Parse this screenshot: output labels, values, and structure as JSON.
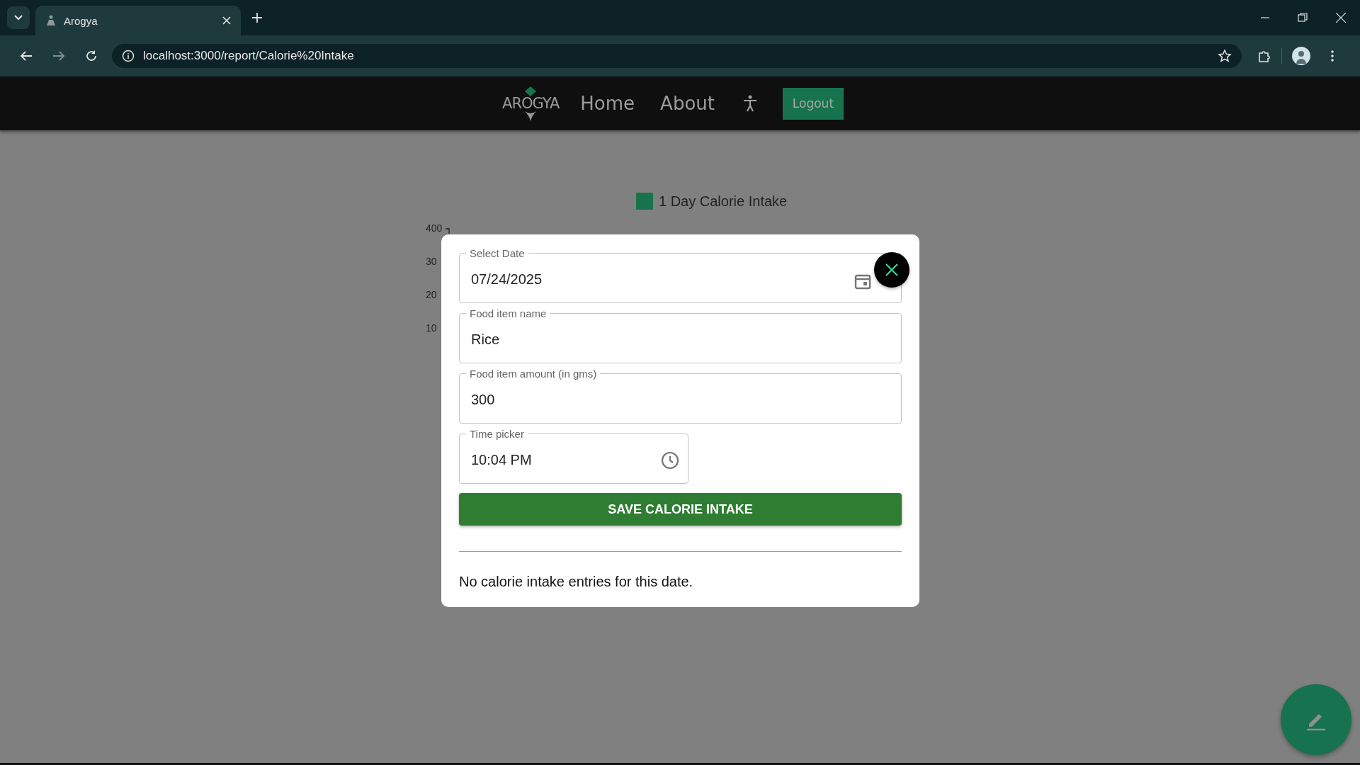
{
  "browser": {
    "tab_title": "Arogya",
    "url": "localhost:3000/report/Calorie%20Intake"
  },
  "nav": {
    "logo": "AROGYA",
    "links": [
      "Home",
      "About"
    ],
    "logout": "Logout"
  },
  "chart": {
    "legend": "1 Day Calorie Intake",
    "y_ticks": [
      "400",
      "30",
      "20",
      "10"
    ]
  },
  "modal": {
    "fields": [
      {
        "kind": "date",
        "label": "Select Date",
        "value": "07/24/2025"
      },
      {
        "kind": "text",
        "label": "Food item name",
        "value": "Rice"
      },
      {
        "kind": "text",
        "label": "Food item amount (in gms)",
        "value": "300"
      },
      {
        "kind": "time",
        "label": "Time picker",
        "value": "10:04 PM"
      }
    ],
    "save_button": "SAVE CALORIE INTAKE",
    "empty_message": "No calorie intake entries for this date."
  }
}
